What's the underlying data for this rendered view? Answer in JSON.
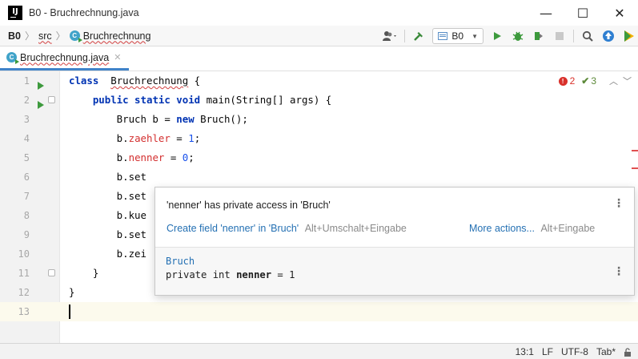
{
  "window": {
    "title": "B0 - Bruchrechnung.java",
    "app_badge": "IJ",
    "controls": [
      "—",
      "☐",
      "✕"
    ]
  },
  "breadcrumbs": [
    "B0",
    "src",
    "Bruchrechnung"
  ],
  "toolbar": {
    "run_config": "B0",
    "icons": [
      "user-icon",
      "hammer-icon",
      "run-icon",
      "debug-icon",
      "coverage-icon",
      "stop-icon",
      "search-icon",
      "update-icon",
      "plugin-icon"
    ]
  },
  "tab": {
    "label": "Bruchrechnung.java"
  },
  "inspection": {
    "errors": "2",
    "warnings": "3"
  },
  "code": {
    "lines": [
      {
        "num": "1",
        "parts": [
          [
            "kw",
            "class"
          ],
          [
            "",
            "  "
          ],
          [
            "sq",
            "Bruchrechnung"
          ],
          [
            "",
            " {"
          ]
        ]
      },
      {
        "num": "2",
        "parts": [
          [
            "",
            "    "
          ],
          [
            "kw",
            "public static void"
          ],
          [
            "",
            " main(String[] args) {"
          ]
        ]
      },
      {
        "num": "3",
        "parts": [
          [
            "",
            "        Bruch b = "
          ],
          [
            "kw",
            "new"
          ],
          [
            "",
            " Bruch();"
          ]
        ]
      },
      {
        "num": "4",
        "parts": [
          [
            "",
            "        b."
          ],
          [
            "fld",
            "zaehler"
          ],
          [
            "",
            " = "
          ],
          [
            "num",
            "1"
          ],
          [
            "",
            ";"
          ]
        ]
      },
      {
        "num": "5",
        "parts": [
          [
            "",
            "        b."
          ],
          [
            "fld",
            "nenner"
          ],
          [
            "",
            " = "
          ],
          [
            "num",
            "0"
          ],
          [
            "",
            ";"
          ]
        ]
      },
      {
        "num": "6",
        "parts": [
          [
            "",
            "        b.set"
          ]
        ]
      },
      {
        "num": "7",
        "parts": [
          [
            "",
            "        b.set"
          ]
        ]
      },
      {
        "num": "8",
        "parts": [
          [
            "",
            "        b.kue"
          ]
        ]
      },
      {
        "num": "9",
        "parts": [
          [
            "",
            "        b.set"
          ]
        ]
      },
      {
        "num": "10",
        "parts": [
          [
            "",
            "        b.zei"
          ]
        ]
      },
      {
        "num": "11",
        "parts": [
          [
            "",
            "    }"
          ]
        ]
      },
      {
        "num": "12",
        "parts": [
          [
            "",
            "}"
          ]
        ]
      },
      {
        "num": "13",
        "parts": []
      }
    ]
  },
  "popup": {
    "message": "'nenner' has private access in 'Bruch'",
    "action": "Create field 'nenner' in 'Bruch'",
    "action_shortcut": "Alt+Umschalt+Eingabe",
    "more_actions": "More actions...",
    "more_shortcut": "Alt+Eingabe",
    "doc_class": "Bruch",
    "doc_sig_pre": "private int ",
    "doc_sig_name": "nenner",
    "doc_sig_post": " = 1"
  },
  "status": {
    "position": "13:1",
    "line_sep": "LF",
    "encoding": "UTF-8",
    "indent": "Tab*"
  }
}
